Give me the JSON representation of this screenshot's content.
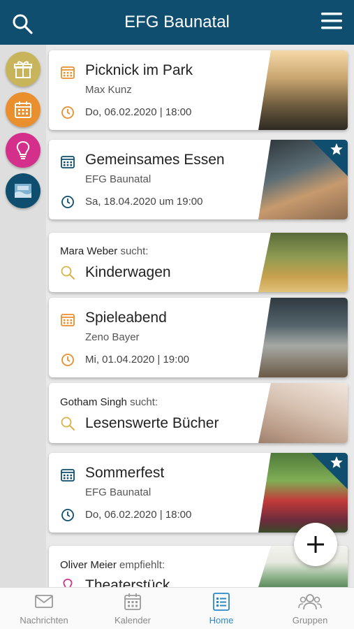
{
  "header": {
    "title": "EFG Baunatal"
  },
  "side": {
    "icons": [
      {
        "name": "gift-icon",
        "color": "#c8b45a"
      },
      {
        "name": "calendar-icon",
        "color": "#e98f2e"
      },
      {
        "name": "lightbulb-icon",
        "color": "#d42f8a"
      },
      {
        "name": "baptism-icon",
        "color": "#0f4e6e"
      }
    ]
  },
  "cards": [
    {
      "title": "Picknick im Park",
      "author": "Max Kunz",
      "date": "Do, 06.02.2020 | 18:00"
    },
    {
      "title": "Gemeinsames Essen",
      "author": "EFG Baunatal",
      "date": "Sa, 18.04.2020 um 19:00"
    },
    {
      "person": "Mara Weber",
      "verb": "sucht:",
      "title": "Kinderwagen"
    },
    {
      "title": "Spieleabend",
      "author": "Zeno Bayer",
      "date": "Mi, 01.04.2020 | 19:00"
    },
    {
      "person": "Gotham Singh",
      "verb": "sucht:",
      "title": "Lesenswerte Bücher"
    },
    {
      "title": "Sommerfest",
      "author": "EFG Baunatal",
      "date": "Do, 06.02.2020 | 18:00"
    },
    {
      "person": "Oliver Meier",
      "verb": "empfiehlt:",
      "title": "Theaterstück"
    }
  ],
  "tabs": [
    {
      "label": "Nachrichten"
    },
    {
      "label": "Kalender"
    },
    {
      "label": "Home"
    },
    {
      "label": "Gruppen"
    }
  ],
  "colors": {
    "primary": "#0f4e6e",
    "accent": "#2b88c8",
    "orange": "#e98f2e",
    "search_yellow": "#d9b347"
  }
}
